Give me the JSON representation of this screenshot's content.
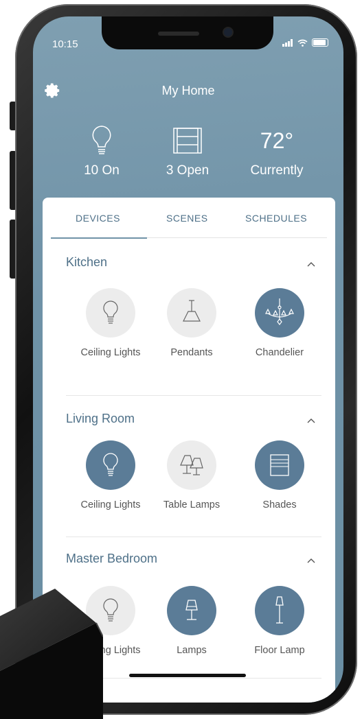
{
  "status_bar": {
    "time": "10:15"
  },
  "header": {
    "title": "My Home"
  },
  "summary": {
    "lights_label": "10 On",
    "shades_label": "3 Open",
    "temperature": "72°",
    "temperature_label": "Currently"
  },
  "tabs": [
    {
      "label": "DEVICES",
      "active": true
    },
    {
      "label": "SCENES",
      "active": false
    },
    {
      "label": "SCHEDULES",
      "active": false
    }
  ],
  "rooms": [
    {
      "name": "Kitchen",
      "devices": [
        {
          "label": "Ceiling Lights",
          "icon": "bulb-icon",
          "on": false
        },
        {
          "label": "Pendants",
          "icon": "pendant-icon",
          "on": false
        },
        {
          "label": "Chandelier",
          "icon": "chandelier-icon",
          "on": true
        }
      ]
    },
    {
      "name": "Living Room",
      "devices": [
        {
          "label": "Ceiling Lights",
          "icon": "bulb-icon",
          "on": true
        },
        {
          "label": "Table Lamps",
          "icon": "table-lamps-icon",
          "on": false
        },
        {
          "label": "Shades",
          "icon": "shade-icon",
          "on": true
        }
      ]
    },
    {
      "name": "Master Bedroom",
      "devices": [
        {
          "label": "Ceiling Lights",
          "icon": "bulb-icon",
          "on": false
        },
        {
          "label": "Lamps",
          "icon": "lamp-icon",
          "on": true
        },
        {
          "label": "Floor Lamp",
          "icon": "floor-lamp-icon",
          "on": true
        }
      ]
    }
  ],
  "colors": {
    "accent": "#5b7c97",
    "header_bg": "#6f92a7",
    "off_circle": "#ececec"
  }
}
